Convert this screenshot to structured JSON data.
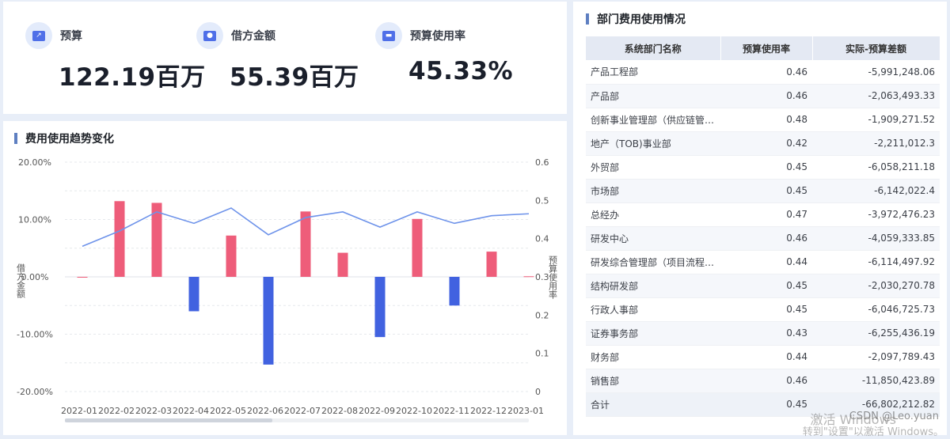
{
  "kpis": [
    {
      "label": "预算",
      "value": "122.19百万",
      "icon": "trend-chart-icon"
    },
    {
      "label": "借方金额",
      "value": "55.39百万",
      "icon": "people-icon"
    },
    {
      "label": "预算使用率",
      "value": "45.33%",
      "icon": "card-icon"
    }
  ],
  "trend": {
    "title": "费用使用趋势变化"
  },
  "chart_data": {
    "type": "bar",
    "title": "费用使用趋势变化",
    "categories": [
      "2022-01",
      "2022-02",
      "2022-03",
      "2022-04",
      "2022-05",
      "2022-06",
      "2022-07",
      "2022-08",
      "2022-09",
      "2022-10",
      "2022-11",
      "2022-12",
      "2023-01"
    ],
    "ylabel": "借方金额",
    "y2label": "预算使用率",
    "ylim": [
      -20,
      20
    ],
    "y2lim": [
      0,
      0.6
    ],
    "yticks": [
      "20.00%",
      "10.00%",
      "0.00%",
      "-10.00%",
      "-20.00%"
    ],
    "y2ticks": [
      "0.6",
      "0.5",
      "0.4",
      "0.3",
      "0.2",
      "0.1",
      "0"
    ],
    "series": [
      {
        "type": "bar",
        "values": [
          0,
          13.2,
          12.9,
          -6.0,
          7.2,
          -15.3,
          11.4,
          4.2,
          -10.5,
          10.1,
          -5.0,
          4.4,
          0.1
        ],
        "pos_color": "#ee5d7a",
        "neg_color": "#4162e0"
      },
      {
        "type": "line",
        "axis": "right",
        "values": [
          0.38,
          0.42,
          0.47,
          0.44,
          0.48,
          0.41,
          0.455,
          0.47,
          0.43,
          0.47,
          0.44,
          0.46,
          0.465
        ],
        "color": "#6e93ea"
      }
    ],
    "grid": true
  },
  "table": {
    "title": "部门费用使用情况",
    "columns": [
      "系统部门名称",
      "预算使用率",
      "实际-预算差额"
    ],
    "rows": [
      [
        "产品工程部",
        "0.46",
        "-5,991,248.06"
      ],
      [
        "产品部",
        "0.46",
        "-2,063,493.33"
      ],
      [
        "创新事业管理部（供应链管…",
        "0.48",
        "-1,909,271.52"
      ],
      [
        "地产（TOB)事业部",
        "0.42",
        "-2,211,012.3"
      ],
      [
        "外贸部",
        "0.45",
        "-6,058,211.18"
      ],
      [
        "市场部",
        "0.45",
        "-6,142,022.4"
      ],
      [
        "总经办",
        "0.47",
        "-3,972,476.23"
      ],
      [
        "研发中心",
        "0.46",
        "-4,059,333.85"
      ],
      [
        "研发综合管理部（项目流程…",
        "0.44",
        "-6,114,497.92"
      ],
      [
        "结构研发部",
        "0.45",
        "-2,030,270.78"
      ],
      [
        "行政人事部",
        "0.45",
        "-6,046,725.73"
      ],
      [
        "证券事务部",
        "0.43",
        "-6,255,436.19"
      ],
      [
        "财务部",
        "0.44",
        "-2,097,789.43"
      ],
      [
        "销售部",
        "0.46",
        "-11,850,423.89"
      ]
    ],
    "total": [
      "合计",
      "0.45",
      "-66,802,212.82"
    ]
  },
  "watermark": {
    "line1": "激活 Windows",
    "line2": "转到\"设置\"以激活 Windows。",
    "csdn": "CSDN @Leo.yuan"
  }
}
